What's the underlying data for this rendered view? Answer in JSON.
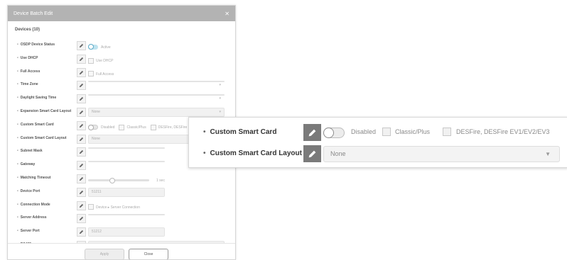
{
  "modal": {
    "title": "Device Batch Edit",
    "close_icon": "close-icon",
    "devices_label": "Devices (10)",
    "rows": [
      {
        "label": "OSDP Device Status",
        "type": "toggle",
        "toggle_state": "on",
        "text": "Active"
      },
      {
        "label": "Use DHCP",
        "type": "checkbox",
        "text": "Use DHCP"
      },
      {
        "label": "Full Access",
        "type": "checkbox",
        "text": "Full Access"
      },
      {
        "label": "Time Zone",
        "type": "select",
        "value": ""
      },
      {
        "label": "Daylight Saving Time",
        "type": "select",
        "value": ""
      },
      {
        "label": "Expansion Smart Card Layout",
        "type": "select",
        "value": "None"
      },
      {
        "label": "Custom Smart Card",
        "type": "toggle-multi",
        "toggle_state": "off",
        "text": "Disabled",
        "options": [
          "Classic/Plus",
          "DESFire, DESFire EV1/EV2/EV3"
        ]
      },
      {
        "label": "Custom Smart Card Layout",
        "type": "select",
        "value": "None"
      },
      {
        "label": "Subnet Mask",
        "type": "input",
        "value": ""
      },
      {
        "label": "Gateway",
        "type": "input",
        "value": ""
      },
      {
        "label": "Matching Timeout",
        "type": "slider",
        "value": "",
        "unit": "1 sec"
      },
      {
        "label": "Device Port",
        "type": "input",
        "value": "51211"
      },
      {
        "label": "Connection Mode",
        "type": "checkbox",
        "text": "Device ▸ Server Connection"
      },
      {
        "label": "Server Address",
        "type": "input",
        "value": ""
      },
      {
        "label": "Server Port",
        "type": "input",
        "value": "51212"
      },
      {
        "label": "RS485",
        "type": "select",
        "value": "Default"
      }
    ],
    "apply_label": "Apply",
    "close_label": "Close"
  },
  "callout": {
    "row1": {
      "label": "Custom Smart Card",
      "toggle_text": "Disabled",
      "option1": "Classic/Plus",
      "option2": "DESFire, DESFire EV1/EV2/EV3"
    },
    "row2": {
      "label": "Custom Smart Card Layout",
      "select_value": "None"
    }
  },
  "colors": {
    "header": "#b3b3b3",
    "pencil_active": "#7a7a7a",
    "toggle_on": "#bfe3ef"
  }
}
